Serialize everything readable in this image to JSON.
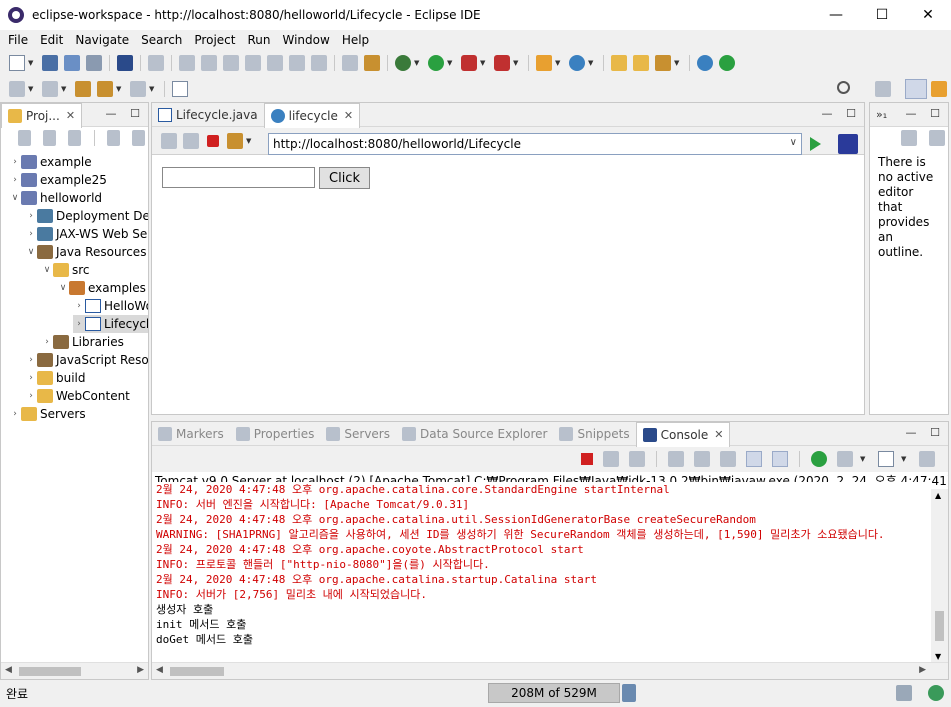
{
  "window": {
    "title": "eclipse-workspace - http://localhost:8080/helloworld/Lifecycle - Eclipse IDE",
    "minimize": "—",
    "maximize": "☐",
    "close": "✕"
  },
  "menu": [
    "File",
    "Edit",
    "Navigate",
    "Search",
    "Project",
    "Run",
    "Window",
    "Help"
  ],
  "project_explorer": {
    "tab_label": "Proj...",
    "tree": [
      {
        "label": "example",
        "depth": 0,
        "expanded": false
      },
      {
        "label": "example25",
        "depth": 0,
        "expanded": false
      },
      {
        "label": "helloworld",
        "depth": 0,
        "expanded": true
      },
      {
        "label": "Deployment Descriptor",
        "depth": 1,
        "expanded": false
      },
      {
        "label": "JAX-WS Web Services",
        "depth": 1,
        "expanded": false
      },
      {
        "label": "Java Resources",
        "depth": 1,
        "expanded": true
      },
      {
        "label": "src",
        "depth": 2,
        "expanded": true
      },
      {
        "label": "examples",
        "depth": 3,
        "expanded": true
      },
      {
        "label": "HelloWorld.java",
        "depth": 4,
        "expanded": false
      },
      {
        "label": "Lifecycle.java",
        "depth": 4,
        "expanded": false,
        "selected": true
      },
      {
        "label": "Libraries",
        "depth": 2,
        "expanded": false
      },
      {
        "label": "JavaScript Resources",
        "depth": 1,
        "expanded": false
      },
      {
        "label": "build",
        "depth": 1,
        "expanded": false
      },
      {
        "label": "WebContent",
        "depth": 1,
        "expanded": false
      },
      {
        "label": "Servers",
        "depth": 0,
        "expanded": false
      }
    ]
  },
  "editor": {
    "tabs": [
      {
        "label": "Lifecycle.java",
        "active": false
      },
      {
        "label": "lifecycle",
        "active": true
      }
    ],
    "url": "http://localhost:8080/helloworld/Lifecycle",
    "page": {
      "input_value": "",
      "button_label": "Click"
    }
  },
  "outline": {
    "message": "There is no active editor that provides an outline."
  },
  "console_panel": {
    "tabs": [
      "Markers",
      "Properties",
      "Servers",
      "Data Source Explorer",
      "Snippets",
      "Console"
    ],
    "active_tab": "Console",
    "title": "Tomcat v9.0 Server at localhost (2) [Apache Tomcat] C:₩Program Files₩Java₩jdk-13.0.2₩bin₩javaw.exe (2020. 2. 24. 오후 4:47:41)",
    "lines": [
      {
        "text": "2월 24, 2020 4:47:48 오후 org.apache.catalina.core.StandardEngine startInternal",
        "color": "red"
      },
      {
        "text": "INFO: 서버 엔진을 시작합니다: [Apache Tomcat/9.0.31]",
        "color": "red"
      },
      {
        "text": "2월 24, 2020 4:47:48 오후 org.apache.catalina.util.SessionIdGeneratorBase createSecureRandom",
        "color": "red"
      },
      {
        "text": "WARNING: [SHA1PRNG] 알고리즘을 사용하여, 세션 ID를 생성하기 위한 SecureRandom 객체를 생성하는데, [1,590] 밀리초가 소요됐습니다.",
        "color": "red"
      },
      {
        "text": "2월 24, 2020 4:47:48 오후 org.apache.coyote.AbstractProtocol start",
        "color": "red"
      },
      {
        "text": "INFO: 프로토콜 핸들러 [\"http-nio-8080\"]을(를) 시작합니다.",
        "color": "red"
      },
      {
        "text": "2월 24, 2020 4:47:48 오후 org.apache.catalina.startup.Catalina start",
        "color": "red"
      },
      {
        "text": "INFO: 서버가 [2,756] 밀리초 내에 시작되었습니다.",
        "color": "red"
      },
      {
        "text": "생성자 호출",
        "color": "black"
      },
      {
        "text": "init 메서드 호출",
        "color": "black"
      },
      {
        "text": "doGet 메서드 호출",
        "color": "black"
      }
    ]
  },
  "status_bar": {
    "text": "완료",
    "heap": "208M of 529M"
  },
  "colors": {
    "console_error": "#d00000",
    "selection": "#d9d9d9",
    "accent": "#3a80c0"
  }
}
